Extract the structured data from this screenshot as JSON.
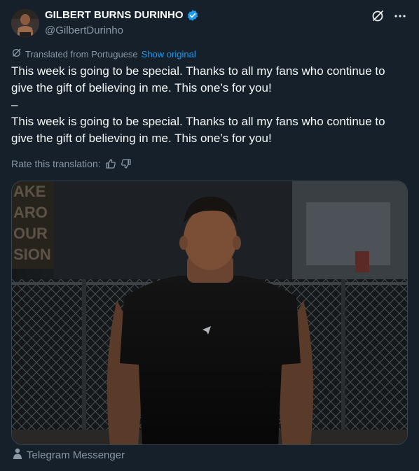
{
  "author": {
    "name": "GILBERT BURNS DURINHO",
    "handle": "@GilbertDurinho",
    "verified": true
  },
  "icons": {
    "grok": "grok-icon",
    "more": "more-icon",
    "translate": "translate-icon",
    "thumbs_up": "thumbs-up-icon",
    "thumbs_down": "thumbs-down-icon",
    "source": "person-icon"
  },
  "translation": {
    "label": "Translated from Portuguese",
    "show_original": "Show original"
  },
  "post": {
    "paragraph1": "This week is going to be special. Thanks to all my fans who continue to give the gift of believing in me. This one’s for you!",
    "separator": "–",
    "paragraph2": "This week is going to be special. Thanks to all my fans who continue to give the gift of believing in me. This one’s for you!"
  },
  "rate": {
    "label": "Rate this translation:"
  },
  "media": {
    "sign_lines": [
      "AKE",
      "ARO",
      "OUR",
      "SION"
    ]
  },
  "source": {
    "label": "Telegram Messenger"
  },
  "colors": {
    "background": "#15202b",
    "accent": "#1d9bf0",
    "muted": "#8b98a5",
    "text": "#f7f9f9"
  }
}
